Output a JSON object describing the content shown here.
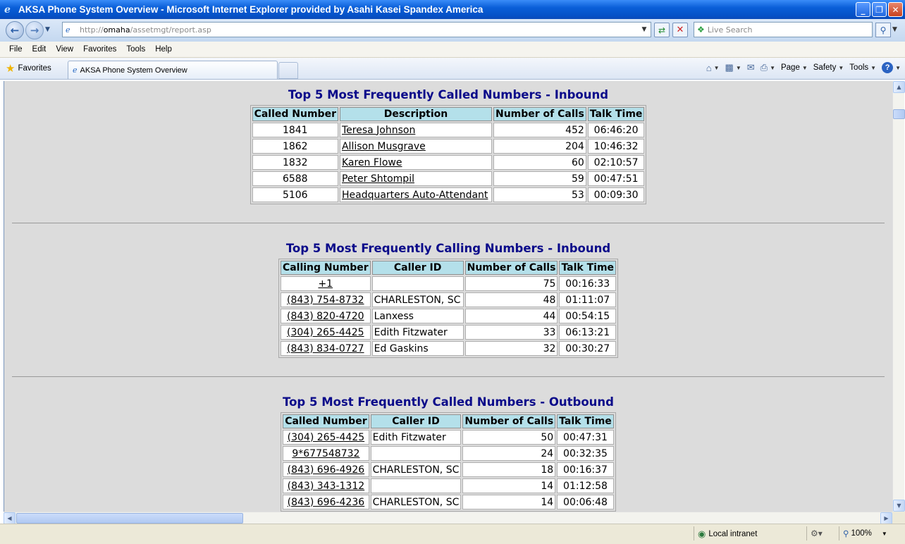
{
  "window": {
    "title": "AKSA Phone System Overview - Microsoft Internet Explorer provided by Asahi Kasei Spandex America",
    "minimize": "_",
    "restore": "❐",
    "close": "✕"
  },
  "address": {
    "url_scheme": "http://",
    "url_host": "omaha",
    "url_path": "/assetmgt/report.asp",
    "search_placeholder": "Live Search"
  },
  "menu": [
    "File",
    "Edit",
    "View",
    "Favorites",
    "Tools",
    "Help"
  ],
  "favorites_label": "Favorites",
  "tab_title": "AKSA Phone System Overview",
  "commands": {
    "page": "Page",
    "safety": "Safety",
    "tools": "Tools"
  },
  "report": {
    "sections": [
      {
        "title": "Top 5 Most Frequently Called Numbers - Inbound",
        "headers": [
          "Called Number",
          "Description",
          "Number of Calls",
          "Talk Time"
        ],
        "rows": [
          [
            "1841",
            "Teresa Johnson",
            "452",
            "06:46:20"
          ],
          [
            "1862",
            "Allison Musgrave",
            "204",
            "10:46:32"
          ],
          [
            "1832",
            "Karen Flowe",
            "60",
            "02:10:57"
          ],
          [
            "6588",
            "Peter Shtompil",
            "59",
            "00:47:51"
          ],
          [
            "5106",
            "Headquarters Auto-Attendant",
            "53",
            "00:09:30"
          ]
        ]
      },
      {
        "title": "Top 5 Most Frequently Calling Numbers - Inbound",
        "headers": [
          "Calling Number",
          "Caller ID",
          "Number of Calls",
          "Talk Time"
        ],
        "rows": [
          [
            "+1",
            "",
            "75",
            "00:16:33"
          ],
          [
            "(843) 754-8732",
            "CHARLESTON, SC",
            "48",
            "01:11:07"
          ],
          [
            "(843) 820-4720",
            "Lanxess",
            "44",
            "00:54:15"
          ],
          [
            "(304) 265-4425",
            "Edith Fitzwater",
            "33",
            "06:13:21"
          ],
          [
            "(843) 834-0727",
            "Ed Gaskins",
            "32",
            "00:30:27"
          ]
        ]
      },
      {
        "title": "Top 5 Most Frequently Called Numbers - Outbound",
        "headers": [
          "Called Number",
          "Caller ID",
          "Number of Calls",
          "Talk Time"
        ],
        "rows": [
          [
            "(304) 265-4425",
            "Edith Fitzwater",
            "50",
            "00:47:31"
          ],
          [
            "9*677548732",
            "",
            "24",
            "00:32:35"
          ],
          [
            "(843) 696-4926",
            "CHARLESTON, SC",
            "18",
            "00:16:37"
          ],
          [
            "(843) 343-1312",
            "",
            "14",
            "01:12:58"
          ],
          [
            "(843) 696-4236",
            "CHARLESTON, SC",
            "14",
            "00:06:48"
          ]
        ]
      }
    ]
  },
  "status": {
    "zone": "Local intranet",
    "zoom": "100%"
  }
}
